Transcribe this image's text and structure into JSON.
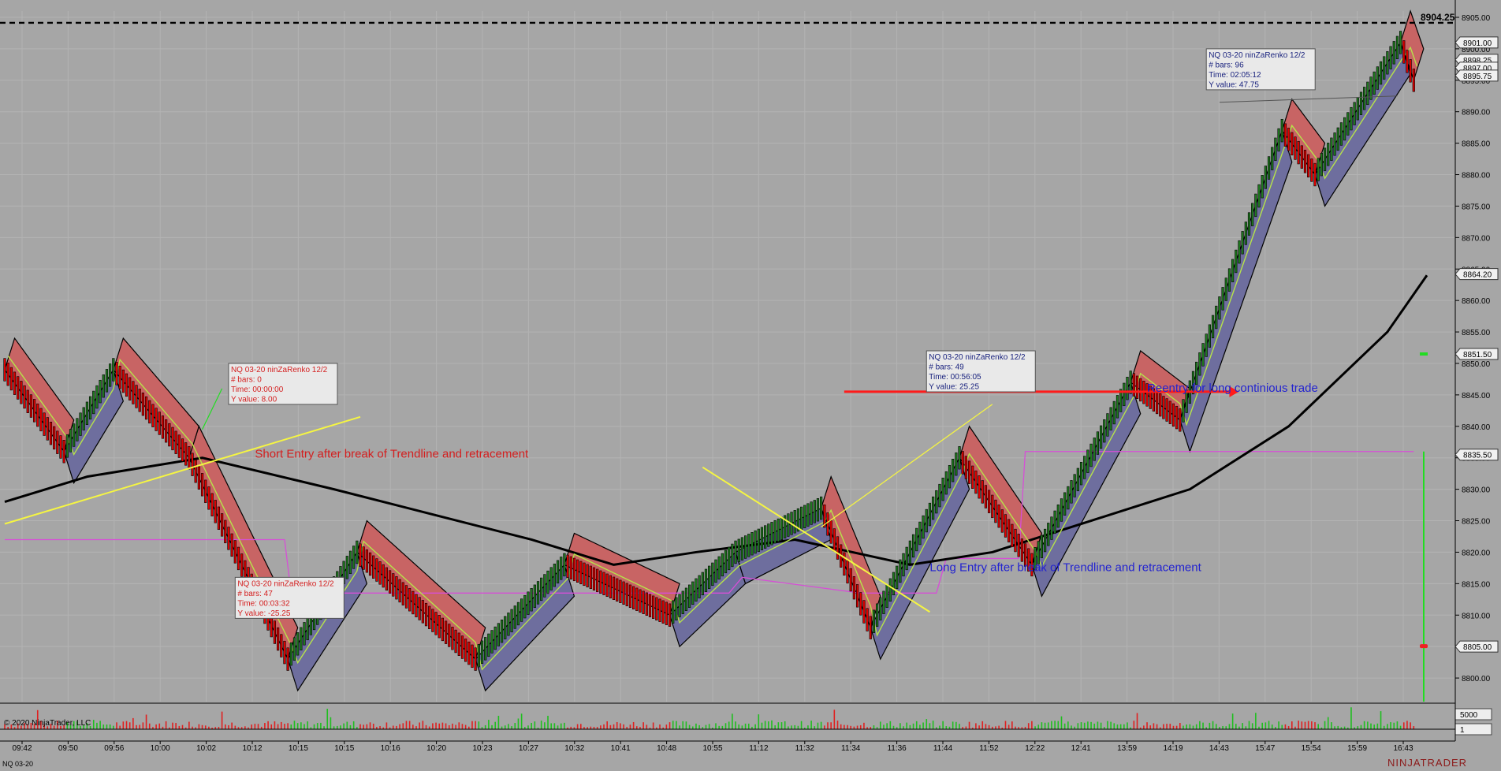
{
  "instrument_footer": "NQ 03-20",
  "copyright": "© 2020 NinjaTrader, LLC",
  "logo_text": "NINJATRADER",
  "chart_data": {
    "type": "candlestick-renko",
    "instrument": "NQ 03-20",
    "bar_type": "ninZaRenko 12/2",
    "ylim": [
      8796,
      8906
    ],
    "y_ticks": [
      8800,
      8805,
      8810,
      8815,
      8820,
      8825,
      8830,
      8835,
      8840,
      8845,
      8850,
      8855,
      8860,
      8865,
      8870,
      8875,
      8880,
      8885,
      8890,
      8895,
      8900,
      8905
    ],
    "y_tick_labels": [
      "8800.00",
      "8805.00",
      "8810.00",
      "8815.00",
      "8820.00",
      "8825.00",
      "8830.00",
      "8835.00",
      "8840.00",
      "8845.00",
      "8850.00",
      "8855.00",
      "8860.00",
      "8865.00",
      "8870.00",
      "8875.00",
      "8880.00",
      "8885.00",
      "8890.00",
      "8895.00",
      "8900.00",
      "8905.00"
    ],
    "x_tick_labels": [
      "09:42",
      "09:50",
      "09:56",
      "10:00",
      "10:02",
      "10:12",
      "10:15",
      "10:15",
      "10:16",
      "10:20",
      "10:23",
      "10:27",
      "10:32",
      "10:41",
      "10:48",
      "10:55",
      "11:12",
      "11:32",
      "11:34",
      "11:36",
      "11:44",
      "11:52",
      "12:22",
      "12:41",
      "13:59",
      "14:19",
      "14:43",
      "15:47",
      "15:54",
      "15:59",
      "16:43"
    ],
    "bar_count": 300,
    "price_path": [
      [
        0,
        8849
      ],
      [
        18,
        8836
      ],
      [
        33,
        8849
      ],
      [
        56,
        8835
      ],
      [
        86,
        8803
      ],
      [
        107,
        8820
      ],
      [
        143,
        8803
      ],
      [
        170,
        8818
      ],
      [
        202,
        8810
      ],
      [
        222,
        8820
      ],
      [
        248,
        8827
      ],
      [
        263,
        8808
      ],
      [
        290,
        8835
      ],
      [
        312,
        8818
      ],
      [
        342,
        8847
      ],
      [
        357,
        8841
      ],
      [
        388,
        8887
      ],
      [
        398,
        8880
      ],
      [
        424,
        8901
      ],
      [
        428,
        8895
      ]
    ],
    "line_series": [
      {
        "color": "#000000",
        "points": [
          [
            0,
            8828
          ],
          [
            25,
            8832
          ],
          [
            60,
            8835
          ],
          [
            100,
            8830
          ],
          [
            130,
            8826
          ],
          [
            160,
            8822
          ],
          [
            185,
            8818
          ],
          [
            210,
            8820
          ],
          [
            240,
            8822
          ],
          [
            275,
            8818
          ],
          [
            300,
            8820
          ],
          [
            330,
            8825
          ],
          [
            360,
            8830
          ],
          [
            390,
            8840
          ],
          [
            420,
            8855
          ],
          [
            432,
            8864
          ]
        ]
      }
    ],
    "price_labels": [
      {
        "text": "8901.00",
        "y": 8901.0,
        "style": "light"
      },
      {
        "text": "8898.25",
        "y": 8898.25,
        "style": "light"
      },
      {
        "text": "8897.00",
        "y": 8897.0,
        "style": "light"
      },
      {
        "text": "8895.75",
        "y": 8895.75,
        "style": "light"
      },
      {
        "text": "8864.20",
        "y": 8864.2,
        "style": "light"
      },
      {
        "text": "8851.50",
        "y": 8851.5,
        "style": "light"
      },
      {
        "text": "8835.50",
        "y": 8835.5,
        "style": "light"
      },
      {
        "text": "8805.00",
        "y": 8805.0,
        "style": "light"
      }
    ],
    "top_price": {
      "text": "8904.25",
      "y": 8904.25
    },
    "annotations": [
      {
        "text": "Short  Entry after break of Trendline and retracement",
        "color": "#d41f1f",
        "x": 76,
        "y": 8835
      },
      {
        "text": "Long Entry after break of Trendline and retracement",
        "color": "#2323d0",
        "x": 281,
        "y": 8817
      },
      {
        "text": "Reentry for long continious trade",
        "color": "#2323d0",
        "x": 347,
        "y": 8845.5
      }
    ],
    "info_boxes": [
      {
        "color": "#d41f1f",
        "x": 68,
        "y": 8850,
        "lines": [
          "NQ 03-20 ninZaRenko 12/2",
          "# bars:    0",
          "Time:       00:00:00",
          "Y value:  8.00"
        ]
      },
      {
        "color": "#d41f1f",
        "x": 70,
        "y": 8816,
        "lines": [
          "NQ 03-20 ninZaRenko 12/2",
          "# bars:    47",
          "Time:       00:03:32",
          "Y value:  -25.25"
        ]
      },
      {
        "color": "#1a237e",
        "x": 280,
        "y": 8852,
        "lines": [
          "NQ 03-20 ninZaRenko 12/2",
          "# bars:    49",
          "Time:       00:56:05",
          "Y value:  25.25"
        ]
      },
      {
        "color": "#1a237e",
        "x": 365,
        "y": 8900,
        "lines": [
          "NQ 03-20 ninZaRenko 12/2",
          "# bars:    96",
          "Time:       02:05:12",
          "Y value:  47.75"
        ]
      }
    ],
    "volume_labels": [
      "5000",
      "1"
    ],
    "legend": "none",
    "grid": true
  }
}
